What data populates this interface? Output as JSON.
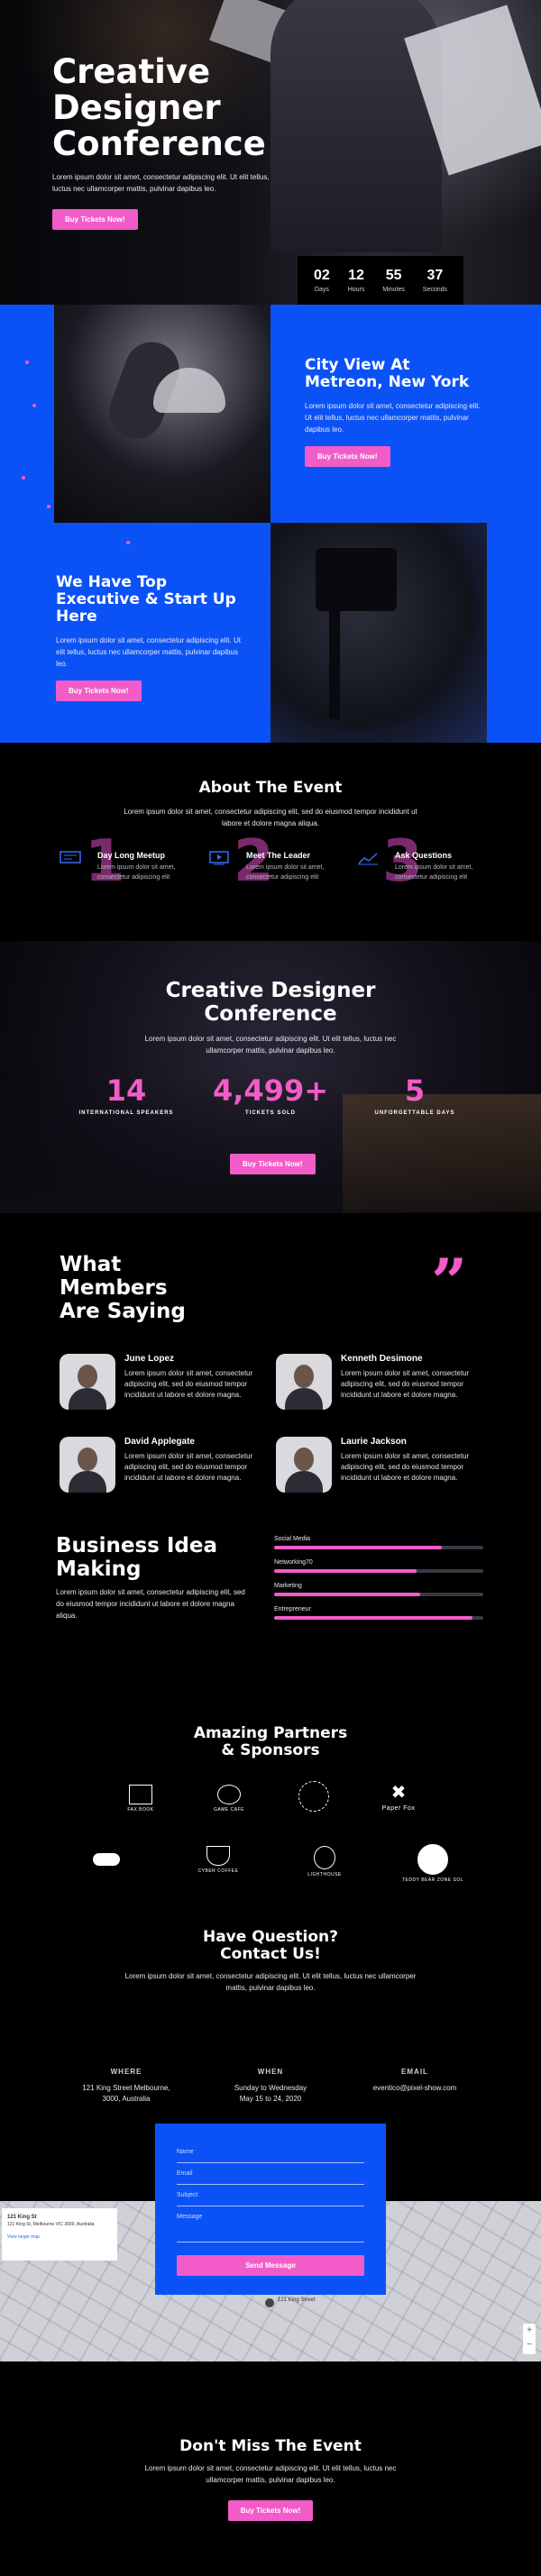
{
  "hero": {
    "title_line1": "Creative",
    "title_line2": "Designer",
    "title_line3": "Conference",
    "subtitle": "Lorem ipsum dolor sit amet, consectetur adipiscing elit. Ut elit tellus, luctus nec ullamcorper mattis, pulvinar dapibus leo.",
    "cta": "Buy Tickets Now!",
    "countdown": [
      {
        "value": "02",
        "label": "Days"
      },
      {
        "value": "12",
        "label": "Hours"
      },
      {
        "value": "55",
        "label": "Minutes"
      },
      {
        "value": "37",
        "label": "Seconds"
      }
    ]
  },
  "venue": {
    "title": "City View At Metreon, New York",
    "text": "Lorem ipsum dolor sit amet, consectetur adipiscing elit. Ut elit tellus, luctus nec ullamcorper mattis, pulvinar dapibus leo.",
    "cta": "Buy Tickets Now!"
  },
  "speakers_block": {
    "title": "We Have Top Executive & Start Up Here",
    "text": "Lorem ipsum dolor sit amet, consectetur adipiscing elit. Ut elit tellus, luctus nec ullamcorper mattis, pulvinar dapibus leo.",
    "cta": "Buy Tickets Now!"
  },
  "about": {
    "title": "About The Event",
    "text": "Lorem ipsum dolor sit amet, consectetur adipiscing elit, sed do eiusmod tempor incididunt ut labore et dolore magna aliqua.",
    "features": [
      {
        "num": "1",
        "title": "Day Long Meetup",
        "desc": "Lorem ipsum dolor sit amet, consectetur adipiscing elit",
        "icon": "presentation-icon"
      },
      {
        "num": "2",
        "title": "Meet The Leader",
        "desc": "Lorem ipsum dolor sit amet, consectetur adipiscing elit",
        "icon": "video-icon"
      },
      {
        "num": "3",
        "title": "Ask Questions",
        "desc": "Lorem ipsum dolor sit amet, consectetur adipiscing elit",
        "icon": "chart-icon"
      }
    ]
  },
  "stats": {
    "title_line1": "Creative Designer",
    "title_line2": "Conference",
    "text": "Lorem ipsum dolor sit amet, consectetur adipiscing elit. Ut elit tellus, luctus nec ullamcorper mattis, pulvinar dapibus leo.",
    "counters": [
      {
        "value": "14",
        "label": "INTERNATIONAL SPEAKERS"
      },
      {
        "value": "4,499+",
        "label": "TICKETS SOLD"
      },
      {
        "value": "5",
        "label": "UNFORGETTABLE DAYS"
      }
    ],
    "cta": "Buy Tickets Now!"
  },
  "testimonials": {
    "title_line1": "What",
    "title_line2": "Members",
    "title_line3": "Are Saying",
    "quote_glyph": "”",
    "items": [
      {
        "name": "June Lopez",
        "text": "Lorem ipsum dolor sit amet, consectetur adipiscing elit, sed do eiusmod tempor incididunt ut labore et dolore magna."
      },
      {
        "name": "Kenneth Desimone",
        "text": "Lorem ipsum dolor sit amet, consectetur adipiscing elit, sed do eiusmod tempor incididunt ut labore et dolore magna."
      },
      {
        "name": "David Applegate",
        "text": "Lorem ipsum dolor sit amet, consectetur adipiscing elit, sed do eiusmod tempor incididunt ut labore et dolore magna."
      },
      {
        "name": "Laurie Jackson",
        "text": "Lorem ipsum dolor sit amet, consectetur adipiscing elit, sed do eiusmod tempor incididunt ut labore et dolore magna."
      }
    ]
  },
  "business": {
    "title_line1": "Business Idea",
    "title_line2": "Making",
    "text": "Lorem ipsum dolor sit amet, consectetur adipiscing elit, sed do eiusmod tempor incididunt ut labore et dolore magna aliqua.",
    "bars": [
      {
        "label": "Social Media",
        "value": 0.8
      },
      {
        "label": "Networking70",
        "value": 0.68
      },
      {
        "label": "Marketing",
        "value": 0.7
      },
      {
        "label": "Entrepreneur",
        "value": 0.95
      }
    ]
  },
  "partners": {
    "title_line1": "Amazing Partners",
    "title_line2": "& Sponsors",
    "logos": [
      "FAX BOOK",
      "GAME CAFE",
      "",
      "Paper Fox",
      "",
      "CYBER COFFEE",
      "LIGHTHOUSE",
      "TEDDY BEAR ZONE SOL"
    ]
  },
  "contact": {
    "title_line1": "Have Question?",
    "title_line2": "Contact Us!",
    "text": "Lorem ipsum dolor sit amet, consectetur adipiscing elit. Ut elit tellus, luctus nec ullamcorper mattis, pulvinar dapibus leo.",
    "info": [
      {
        "heading": "WHERE",
        "line1": "121 King Street Melbourne,",
        "line2": "3000, Australia"
      },
      {
        "heading": "WHEN",
        "line1": "Sunday to Wednesday",
        "line2": "May 15 to 24, 2020"
      },
      {
        "heading": "EMAIL",
        "line1": "eventico@pixel-show.com",
        "line2": ""
      }
    ],
    "form": {
      "name_placeholder": "Name",
      "email_placeholder": "Email",
      "subject_placeholder": "Subject",
      "message_placeholder": "Message",
      "submit": "Send Message"
    },
    "map": {
      "card_title": "121 King St",
      "card_address": "121 King St, Melbourne VIC 3000, Australia",
      "card_link": "View larger map",
      "pin_label": "121 King Street",
      "zoom_in": "+",
      "zoom_out": "−"
    }
  },
  "final": {
    "title": "Don't Miss The Event",
    "text": "Lorem ipsum dolor sit amet, consectetur adipiscing elit. Ut elit tellus, luctus nec ullamcorper mattis, pulvinar dapibus leo.",
    "cta": "Buy Tickets Now!"
  },
  "colors": {
    "accent": "#f25cc8",
    "blue": "#0b52f6",
    "background": "#000000"
  }
}
